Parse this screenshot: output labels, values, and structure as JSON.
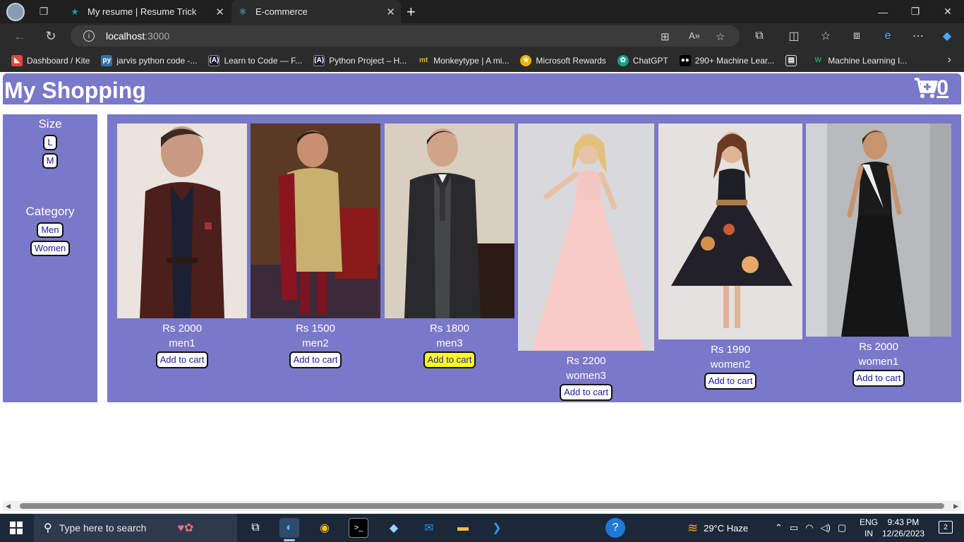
{
  "browser": {
    "tabs": [
      {
        "title": "My resume | Resume Trick",
        "icon": "star-favicon"
      },
      {
        "title": "E-commerce",
        "icon": "react-favicon"
      }
    ],
    "address": {
      "host": "localhost",
      "port": ":3000"
    },
    "bookmarks": [
      {
        "label": "Dashboard / Kite",
        "icon": "kite-icon",
        "color": "#e8453c"
      },
      {
        "label": "jarvis python code -...",
        "icon": "python-icon",
        "color": "#3572A5"
      },
      {
        "label": "Learn to Code — F...",
        "icon": "freecodecamp-icon",
        "color": "#1b1b32"
      },
      {
        "label": "Python Project – H...",
        "icon": "freecodecamp-icon",
        "color": "#1b1b32"
      },
      {
        "label": "Monkeytype | A mi...",
        "icon": "monkeytype-icon",
        "color": "#e2b714"
      },
      {
        "label": "Microsoft Rewards",
        "icon": "medal-icon",
        "color": "#f3b400"
      },
      {
        "label": "ChatGPT",
        "icon": "chatgpt-icon",
        "color": "#10a37f"
      },
      {
        "label": "290+ Machine Lear...",
        "icon": "medium-icon",
        "color": "#000000"
      },
      {
        "label": "Machine Learning I...",
        "icon": "w-icon",
        "color": "#1fa463"
      }
    ]
  },
  "app": {
    "title": "My Shopping",
    "cart_count": "0",
    "accent": "#7a78c9",
    "sidebar": {
      "size_title": "Size",
      "sizes": [
        "L",
        "M"
      ],
      "category_title": "Category",
      "categories": [
        "Men",
        "Women"
      ]
    },
    "products": [
      {
        "price": "Rs 2000",
        "name": "men1",
        "button": "Add to cart"
      },
      {
        "price": "Rs 1500",
        "name": "men2",
        "button": "Add to cart"
      },
      {
        "price": "Rs 1800",
        "name": "men3",
        "button": "Add to cart"
      },
      {
        "price": "Rs 2200",
        "name": "women3",
        "button": "Add to cart"
      },
      {
        "price": "Rs 1990",
        "name": "women2",
        "button": "Add to cart"
      },
      {
        "price": "Rs 2000",
        "name": "women1",
        "button": "Add to cart"
      }
    ]
  },
  "taskbar": {
    "search_placeholder": "Type here to search",
    "weather": "29°C  Haze",
    "lang_top": "ENG",
    "lang_bottom": "IN",
    "time": "9:43 PM",
    "date": "12/26/2023",
    "notifications": "2"
  }
}
